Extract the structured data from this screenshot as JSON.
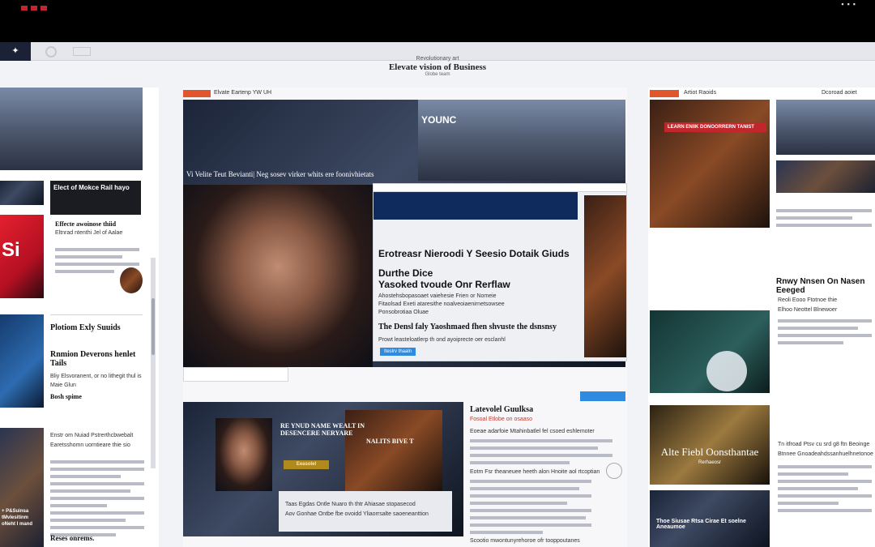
{
  "site": {
    "kicker": "Revolutionary art",
    "name": "Elevate vision of Business",
    "tag": "Globe team"
  },
  "left": {
    "card1_title": "Elect of Mokce Rail hayo",
    "card1_sub": "Effecte awoinose thiid",
    "card1_line": "Eltnrad ntenthi Jel of Aalae",
    "heading1": "Plotiom Exly Suuids",
    "heading2": "Rnmion Deverons henlet Tails",
    "body2": "Bliy Elsvoranent, or no lithegit thul is",
    "body2b": "Maie Glun",
    "sub2": "Bosh spime",
    "body3": "Enstr om Nuiad Pstrerthcbwebalt",
    "body3b": "Earetsshomn uorntieare thie sio",
    "overlay_left": "+ P&Suinsa tMvlesitinm oNeht I mand",
    "footer": "Reses onrems."
  },
  "center": {
    "top_label": "Elvate Eartenp YW UH",
    "hero_overlay": "Vi Velite Teut Bevianti| Neg sosev virker whits ere foonivhietats",
    "hero_sign": "YOUNC",
    "panel_title": "Erotreasr Nieroodi Y Seesio Dotaik Giuds",
    "panel_h2a": "Durthe Dice",
    "panel_h2b": "Yasoked tvoude Onr Rerflaw",
    "panel_l1": "Ahostehsbopasoaet vaiehesie Frien or Nomeie",
    "panel_l2": "Fitaolsad Exeti ataresithe noalveoiaenirnetsowsee",
    "panel_l3": "Ponsobrotiaa Oluae",
    "panel_h3": "The Densl faly Yaoshmaed fhen shvuste the dsnsnsy",
    "panel_l4": "Prowt leasteloatlerp th ond ayoiprecte oer esclanhl",
    "btn": "Iteslrv thaaln",
    "overlay2": "RE YNUD NAME WEALT IN DESENCERE NERYARE",
    "overlay2b": "NALITS BIVE T",
    "overlay2c": "Eeasolel",
    "caption2": "Taas Egdas Ontle Nuaro th thtr Ahiasae stopasecod",
    "caption2b": "Aov Gonhae Ontbe fbe ovoidd Yliaorrsalte saoeneanttion",
    "article_title": "Latevolel Guulksa",
    "article_sub": "Fosoal Etlobe on osaaso",
    "article_body": "Eoeae adarfoie Mtahinbatlel fel csoed eshlemoter",
    "article_body2": "Eotm Fsr theaneuee heeth alon Hnoite aol rtcoptian",
    "article_body3": "Scootio mwontunyrehoroe ofr tooppoutanes"
  },
  "right": {
    "top_label": "Artiot Raoids",
    "top_label2": "Dcoroad aoiet",
    "card_sign": "LEARN ENIIK DONOORRERN TANIST",
    "heading1": "Rnwy Nnsen On Nasen Eeeged",
    "body1": "Reoli Eooo Ftotnoe thie",
    "body1b": "Elhoo Neottel Blnewoer",
    "heading2": "Alte Fiebl Oonsthantae",
    "heading2b": "Rerhaeosr",
    "body2": "Tn itfroad Ptsv cu srd g8 ftn Beoinge",
    "body2b": "Btnnee Gnoadeahdssanhuelhnetonoe",
    "card2": "Thoe Siusae Rtsa Cirae Et soelne Aneaumoe"
  }
}
